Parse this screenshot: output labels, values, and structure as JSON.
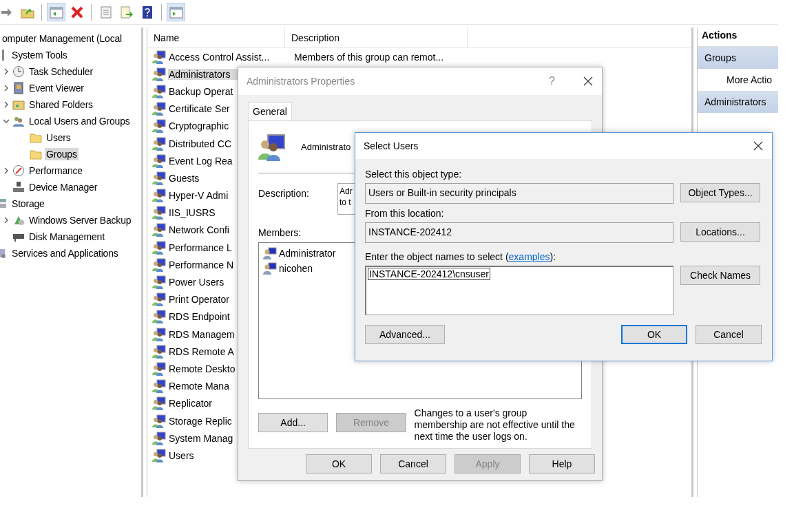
{
  "toolbar": {
    "buttons": [
      {
        "kind": "forward",
        "selected": false
      },
      {
        "kind": "up",
        "selected": false
      },
      {
        "kind": "tree",
        "selected": true
      },
      {
        "kind": "delete",
        "selected": false
      },
      {
        "kind": "properties",
        "selected": false
      },
      {
        "kind": "export",
        "selected": false
      },
      {
        "kind": "help",
        "selected": false
      },
      {
        "kind": "action",
        "selected": true
      }
    ]
  },
  "tree": [
    {
      "label": "omputer Management (Local",
      "selected": false,
      "children": [
        {
          "label": "System Tools",
          "selected": false,
          "children": [
            {
              "label": "Task Scheduler",
              "expanded": false,
              "selected": false
            },
            {
              "label": "Event Viewer",
              "expanded": false,
              "selected": false
            },
            {
              "label": "Shared Folders",
              "expanded": false,
              "selected": false
            },
            {
              "label": "Local Users and Groups",
              "expanded": true,
              "selected": false,
              "children": [
                {
                  "label": "Users",
                  "selected": false
                },
                {
                  "label": "Groups",
                  "selected": true
                }
              ]
            },
            {
              "label": "Performance",
              "expanded": false,
              "selected": false
            },
            {
              "label": "Device Manager",
              "selected": false
            }
          ]
        },
        {
          "label": "Storage",
          "selected": false,
          "children": [
            {
              "label": "Windows Server Backup",
              "expanded": false,
              "selected": false
            },
            {
              "label": "Disk Management",
              "selected": false
            }
          ]
        },
        {
          "label": "Services and Applications",
          "selected": false
        }
      ]
    }
  ],
  "list": {
    "columns": [
      "Name",
      "Description"
    ],
    "rows": [
      {
        "name": "Access Control Assist...",
        "description": "Members of this group can remot...",
        "selected": false
      },
      {
        "name": "Administrators",
        "selected": true
      },
      {
        "name": "Backup Operat",
        "selected": false
      },
      {
        "name": "Certificate Ser",
        "selected": false
      },
      {
        "name": "Cryptographic",
        "selected": false
      },
      {
        "name": "Distributed CC",
        "selected": false
      },
      {
        "name": "Event Log Rea",
        "selected": false
      },
      {
        "name": "Guests",
        "selected": false
      },
      {
        "name": "Hyper-V Admi",
        "selected": false
      },
      {
        "name": "IIS_IUSRS",
        "selected": false
      },
      {
        "name": "Network Confi",
        "selected": false
      },
      {
        "name": "Performance L",
        "selected": false
      },
      {
        "name": "Performance N",
        "selected": false
      },
      {
        "name": "Power Users",
        "selected": false
      },
      {
        "name": "Print Operator",
        "selected": false
      },
      {
        "name": "RDS Endpoint",
        "selected": false
      },
      {
        "name": "RDS Managem",
        "selected": false
      },
      {
        "name": "RDS Remote A",
        "selected": false
      },
      {
        "name": "Remote Deskto",
        "selected": false
      },
      {
        "name": "Remote Mana",
        "selected": false
      },
      {
        "name": "Replicator",
        "selected": false
      },
      {
        "name": "Storage Replic",
        "selected": false
      },
      {
        "name": "System Manag",
        "selected": false
      },
      {
        "name": "Users",
        "selected": false
      }
    ]
  },
  "actions": {
    "title": "Actions",
    "sections": [
      {
        "header": "Groups",
        "items": [
          "More Actio"
        ]
      },
      {
        "header": "Administrators"
      }
    ]
  },
  "properties_dialog": {
    "title": "Administrators Properties",
    "help": "?",
    "tabs": [
      {
        "label": "General",
        "selected": true
      }
    ],
    "group_name": "Administrato",
    "description_label": "Description:",
    "description_lines": [
      "Adr",
      "to t"
    ],
    "members_label": "Members:",
    "members": [
      "Administrator",
      "nicohen"
    ],
    "add_button": {
      "label": "Add...",
      "disabled": false
    },
    "remove_button": {
      "label": "Remove",
      "disabled": true
    },
    "note": "Changes to a user's group membership are not effective until the next time the user logs on.",
    "buttons": [
      {
        "label": "OK",
        "disabled": false
      },
      {
        "label": "Cancel",
        "disabled": false
      },
      {
        "label": "Apply",
        "disabled": true
      },
      {
        "label": "Help",
        "disabled": false
      }
    ]
  },
  "select_users_dialog": {
    "title": "Select Users",
    "object_type_label": "Select this object type:",
    "object_type": "Users or Built-in security principals",
    "object_types_button": "Object Types...",
    "location_label": "From this location:",
    "location": "INSTANCE-202412",
    "locations_button": "Locations...",
    "names_label_before": "Enter the object names to select (",
    "names_link": "examples",
    "names_label_after": "):",
    "names_value": "INSTANCE-202412\\cnsuser",
    "check_names_button": "Check Names",
    "advanced_button": "Advanced...",
    "ok_button": "OK",
    "cancel_button": "Cancel"
  }
}
